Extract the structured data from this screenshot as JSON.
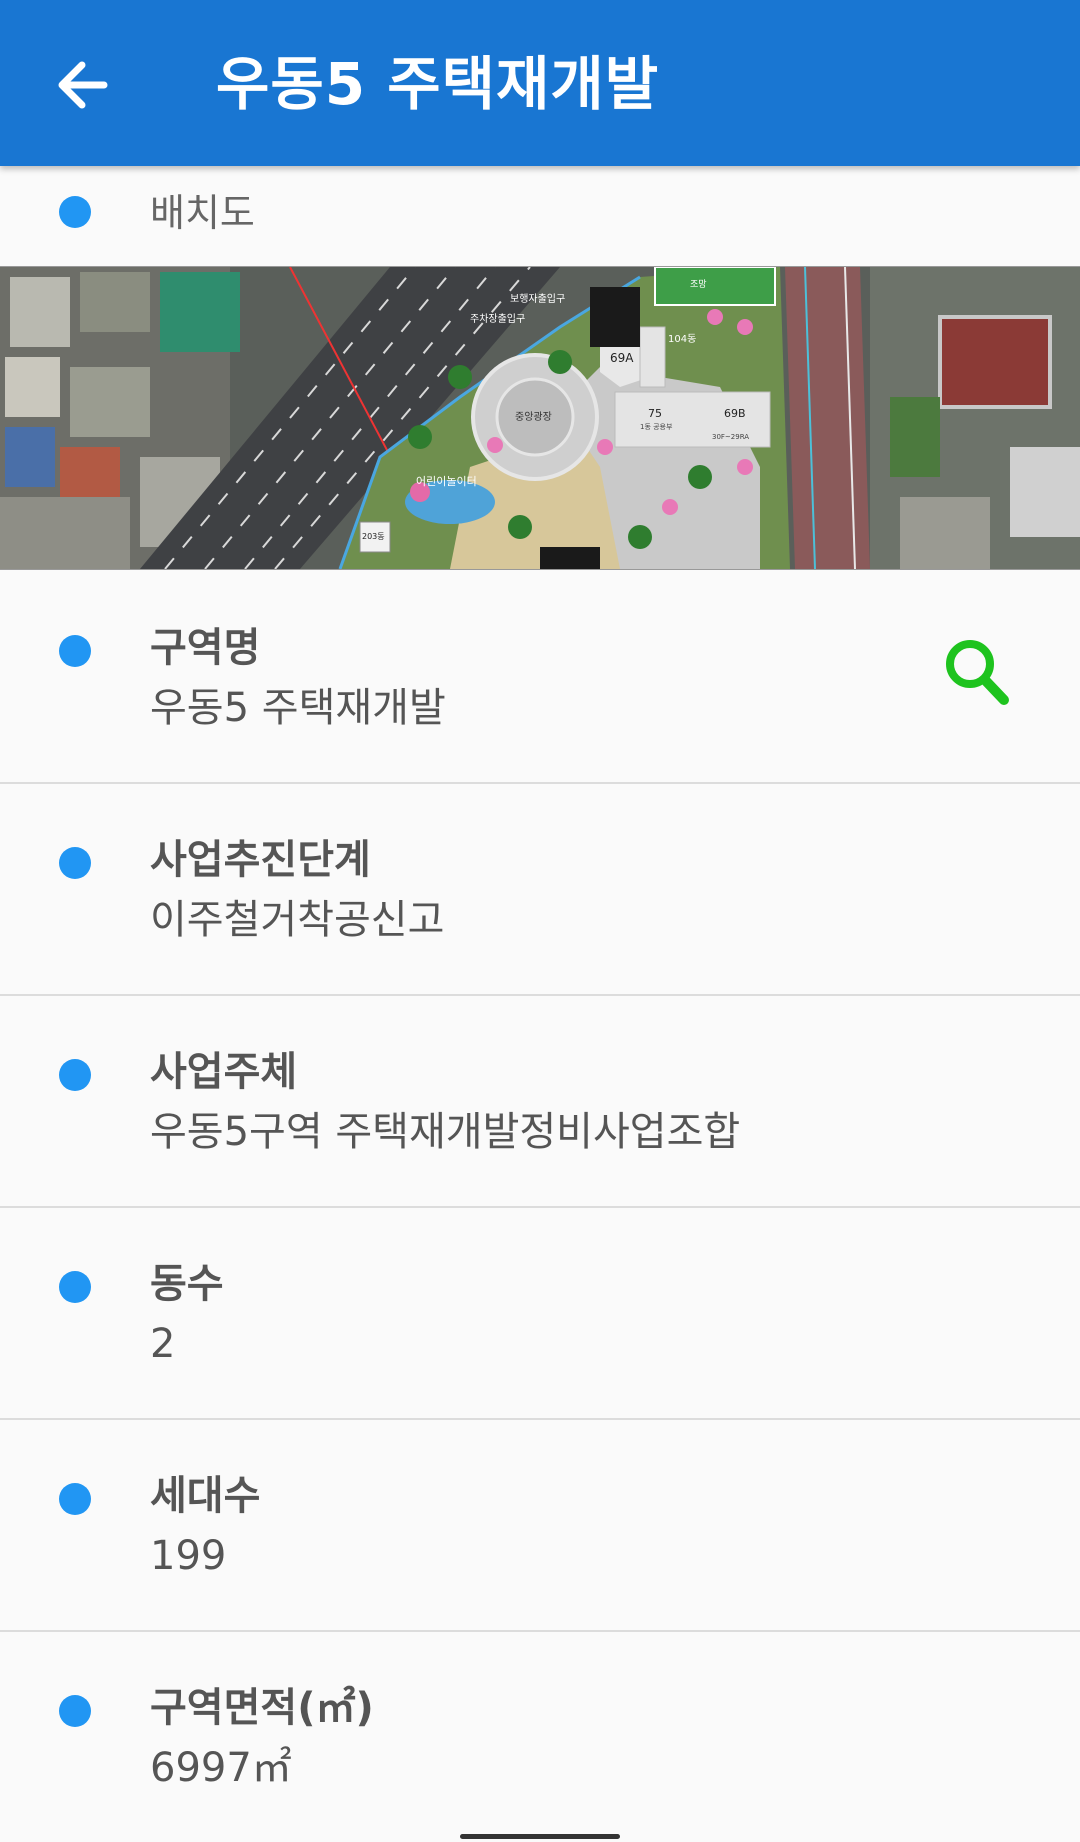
{
  "appbar": {
    "title": "우동5 주택재개발",
    "back_icon": "arrow-left-icon",
    "color": "#1976d2"
  },
  "site_plan": {
    "label": "배치도",
    "map_texts": [
      "보행자출입구",
      "주차장출입구",
      "69A",
      "75",
      "69B",
      "중앙광장",
      "어린이놀이터",
      "203동",
      "1동 공용부",
      "30F~29RA",
      "104동",
      "조망"
    ]
  },
  "details": {
    "district_name": {
      "label": "구역명",
      "value": "우동5 주택재개발",
      "icon": "search-icon"
    },
    "stage": {
      "label": "사업추진단계",
      "value": "이주철거착공신고"
    },
    "operator": {
      "label": "사업주체",
      "value": "우동5구역 주택재개발정비사업조합"
    },
    "buildings": {
      "label": "동수",
      "value": "2"
    },
    "households": {
      "label": "세대수",
      "value": "199"
    },
    "area": {
      "label": "구역면적(㎡)",
      "value": "6997㎡"
    }
  },
  "colors": {
    "bullet": "#2196f3",
    "search_icon": "#1ec31e"
  }
}
